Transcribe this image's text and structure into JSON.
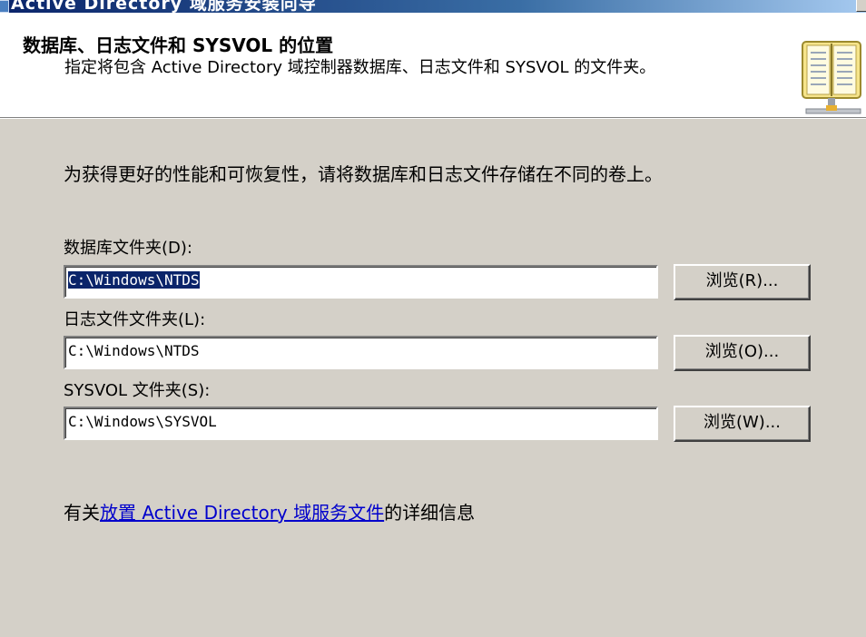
{
  "window": {
    "title": "Active Directory 域服务安装向导"
  },
  "header": {
    "title": "数据库、日志文件和 SYSVOL 的位置",
    "description": "指定将包含 Active Directory 域控制器数据库、日志文件和 SYSVOL 的文件夹。",
    "icon": "book-icon"
  },
  "body": {
    "hint": "为获得更好的性能和可恢复性，请将数据库和日志文件存储在不同的卷上。",
    "fields": [
      {
        "label": "数据库文件夹(D):",
        "value": "C:\\Windows\\NTDS",
        "browse_label": "浏览(R)..."
      },
      {
        "label": "日志文件文件夹(L):",
        "value": "C:\\Windows\\NTDS",
        "browse_label": "浏览(O)..."
      },
      {
        "label": "SYSVOL 文件夹(S):",
        "value": "C:\\Windows\\SYSVOL",
        "browse_label": "浏览(W)..."
      }
    ],
    "info": {
      "prefix": "有关",
      "link": "放置 Active Directory 域服务文件",
      "suffix": "的详细信息"
    }
  },
  "colors": {
    "dialog_bg": "#d4d0c8",
    "selection": "#0a246a",
    "link": "#0000cc"
  }
}
